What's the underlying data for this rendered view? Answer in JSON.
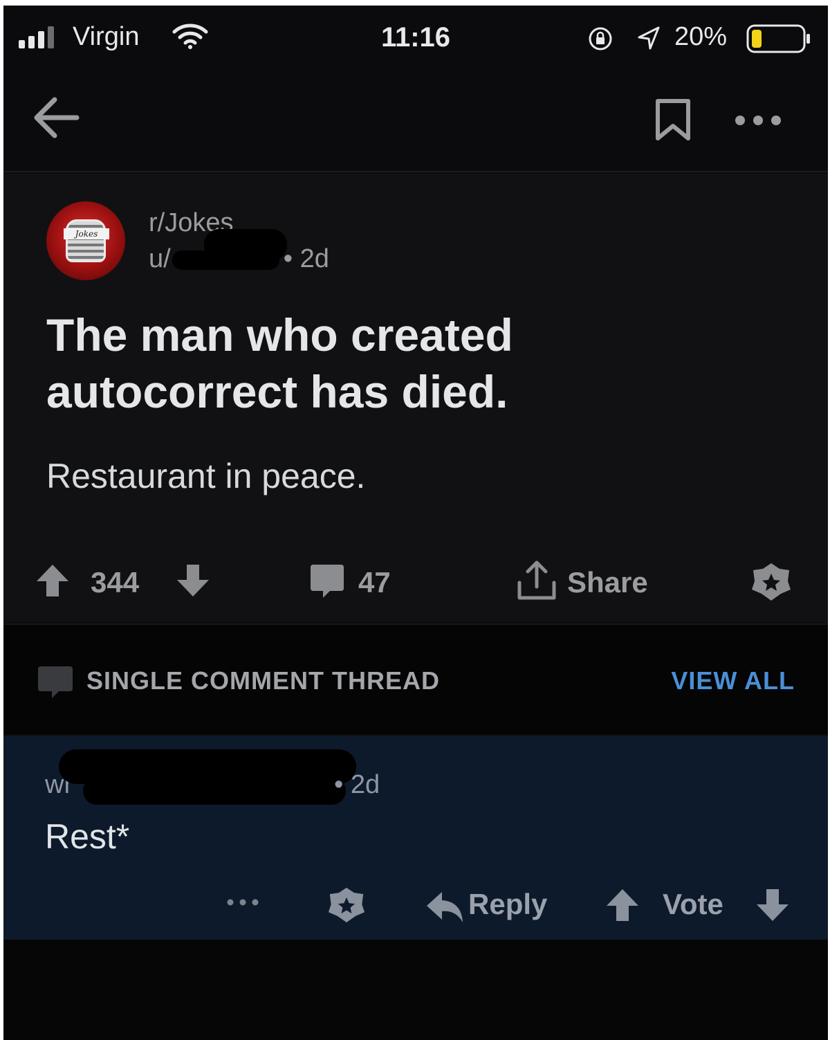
{
  "status_bar": {
    "carrier": "Virgin",
    "time": "11:16",
    "battery_percent": "20%",
    "battery_level": 0.2
  },
  "nav": {
    "icons": [
      "back-arrow-icon",
      "bookmark-icon",
      "more-options-icon"
    ]
  },
  "post": {
    "subreddit": "r/Jokes",
    "user_prefix": "u/",
    "age": "• 2d",
    "avatar_text": "Jokes",
    "title": "The man who created autocorrect has died.",
    "body": "Restaurant in peace.",
    "score": "344",
    "comment_count": "47",
    "share_label": "Share"
  },
  "thread_header": {
    "title": "SINGLE COMMENT THREAD",
    "view_all": "VIEW ALL",
    "accent_color": "#4a8fd6"
  },
  "comment": {
    "author_prefix": "wr",
    "age": "• 2d",
    "body": "Rest*",
    "reply_label": "Reply",
    "vote_label": "Vote"
  },
  "colors": {
    "background": "#0b0b0d",
    "post_background": "#111113",
    "comment_background": "#0d1a2b",
    "link_blue": "#4a8fd6"
  }
}
